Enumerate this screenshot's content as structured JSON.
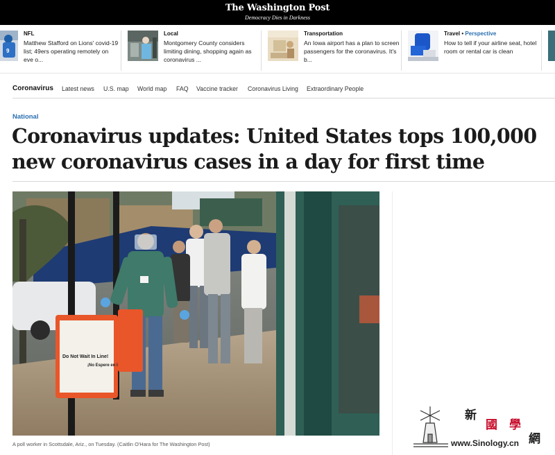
{
  "masthead": {
    "logo": "The Washington Post",
    "tagline": "Democracy Dies in Darkness"
  },
  "story_strip": [
    {
      "category": "NFL",
      "perspective": "",
      "headline": "Matthew Stafford on Lions' covid-19 list; 49ers operating remotely on eve o..."
    },
    {
      "category": "Local",
      "perspective": "",
      "headline": "Montgomery County considers limiting dining, shopping again as coronavirus ..."
    },
    {
      "category": "Transportation",
      "perspective": "",
      "headline": "An Iowa airport has a plan to screen passengers for the coronavirus. It's b..."
    },
    {
      "category": "Travel",
      "perspective": "Perspective",
      "headline": "How to tell if your airline seat, hotel room or rental car is clean"
    }
  ],
  "section_nav": {
    "title": "Coronavirus",
    "links": [
      "Latest news",
      "U.S. map",
      "World map",
      "FAQ",
      "Vaccine tracker",
      "Coronavirus Living",
      "Extraordinary People"
    ]
  },
  "article": {
    "kicker": "National",
    "headline": "Coronavirus updates: United States tops 100,000 new coronavirus cases in a day for first time",
    "photo_caption": "A poll worker in Scottsdale, Ariz., on Tuesday. (Caitlin O'Hara for The Washington Post)",
    "sign_left": "Do Not Wait In Line!",
    "sign_right": "¡No Espere en la Línea!"
  },
  "watermark": {
    "chars": [
      "新",
      "國",
      "學",
      "網"
    ],
    "url": "www.Sinology.cn",
    "color": "#c8102e"
  }
}
